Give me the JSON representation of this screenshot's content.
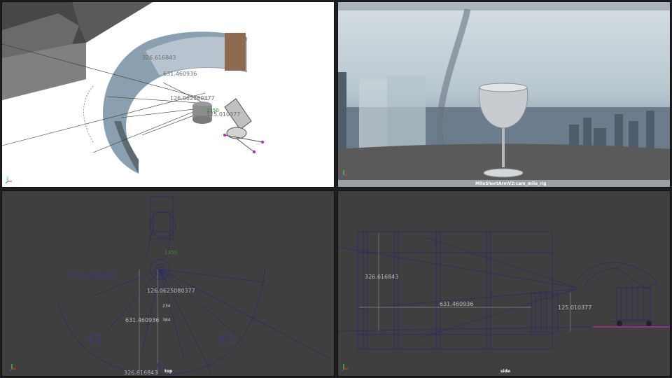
{
  "viewports": {
    "persp": {
      "dimensions": [
        "326.616843",
        "631.460936",
        "126.062580377",
        "125.010377",
        "1350"
      ]
    },
    "cam": {
      "label": "MiloShortArmV2:cam_milo_rig"
    },
    "top": {
      "label": "top",
      "light_label": "translight",
      "angle_left": "45",
      "angle_right": "45",
      "angle_bottom": "0",
      "dimensions": [
        "126.0625080377",
        "631.460936",
        "326.616843",
        "1350"
      ],
      "small_marks": [
        "234",
        "384"
      ]
    },
    "side": {
      "label": "side",
      "dimensions": [
        "326.616843",
        "631.460936",
        "125.010377"
      ]
    }
  },
  "colors": {
    "viewport_bg": "#3f3f3f",
    "wire": "#2a2a6a",
    "axis_x": "#ff3030",
    "axis_y": "#30ff30",
    "axis_z": "#3060ff"
  }
}
